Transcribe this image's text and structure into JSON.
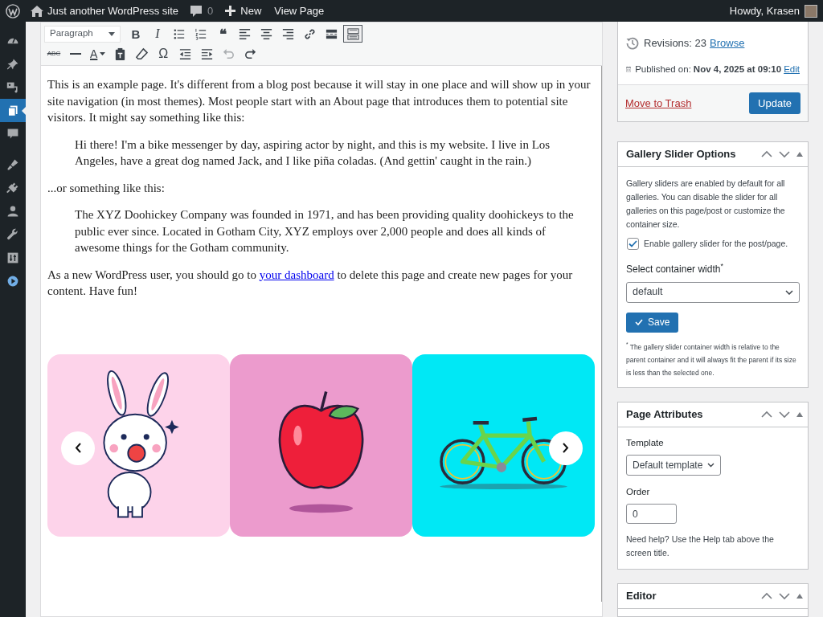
{
  "admin_bar": {
    "site_name": "Just another WordPress site",
    "comments_count": "0",
    "new_label": "New",
    "view_label": "View Page",
    "greeting": "Howdy, Krasen"
  },
  "admin_menu": [
    {
      "kind": "dashboard",
      "selected": false
    },
    {
      "kind": "pin",
      "selected": false
    },
    {
      "kind": "media",
      "selected": false
    },
    {
      "kind": "pages",
      "selected": true
    },
    {
      "kind": "comments",
      "selected": false
    },
    {
      "kind": "brush",
      "selected": false
    },
    {
      "kind": "plug",
      "selected": false
    },
    {
      "kind": "user",
      "selected": false
    },
    {
      "kind": "wrench",
      "selected": false
    },
    {
      "kind": "sliders",
      "selected": false
    },
    {
      "kind": "play",
      "selected": false
    }
  ],
  "toolbar": {
    "format": "Paragraph",
    "row_1": [
      {
        "kind": "bold",
        "glyph": "B",
        "active": false
      },
      {
        "kind": "italic",
        "glyph": "I",
        "active": false
      },
      {
        "kind": "bullets",
        "active": false
      },
      {
        "kind": "numbers",
        "active": false
      },
      {
        "kind": "quote",
        "glyph": "❝",
        "active": false
      },
      {
        "kind": "align-left",
        "active": false
      },
      {
        "kind": "align-center",
        "active": false
      },
      {
        "kind": "align-right",
        "active": false
      },
      {
        "kind": "link",
        "active": false
      },
      {
        "kind": "more",
        "active": false
      },
      {
        "kind": "keyboard",
        "active": true
      }
    ],
    "row_2": [
      {
        "kind": "strike",
        "glyph": "ABC",
        "disabled": false
      },
      {
        "kind": "hr",
        "disabled": false
      },
      {
        "kind": "color",
        "glyph": "A",
        "disabled": false
      },
      {
        "kind": "paste",
        "disabled": false
      },
      {
        "kind": "eraser",
        "disabled": false
      },
      {
        "kind": "omega",
        "glyph": "Ω",
        "disabled": false
      },
      {
        "kind": "outdent",
        "disabled": false
      },
      {
        "kind": "indent",
        "disabled": false
      },
      {
        "kind": "undo",
        "disabled": true
      },
      {
        "kind": "redo",
        "disabled": false
      }
    ]
  },
  "content": [
    {
      "kind": "paragraph",
      "text": "This is an example page. It's different from a blog post because it will stay in one place and will show up in your site navigation (in most themes). Most people start with an About page that introduces them to potential site visitors. It might say something like this:"
    },
    {
      "kind": "quote",
      "text": "Hi there! I'm a bike messenger by day, aspiring actor by night, and this is my website. I live in Los Angeles, have a great dog named Jack, and I like piña coladas. (And gettin' caught in the rain.)"
    },
    {
      "kind": "paragraph",
      "text": "...or something like this:"
    },
    {
      "kind": "quote",
      "text": "The XYZ Doohickey Company was founded in 1971, and has been providing quality doohickeys to the public ever since. Located in Gotham City, XYZ employs over 2,000 people and does all kinds of awesome things for the Gotham community."
    },
    {
      "kind": "link_paragraph",
      "before": "As a new WordPress user, you should go to ",
      "link": "your dashboard",
      "after": " to delete this page and create new pages for your content. Have fun!"
    }
  ],
  "gallery": {
    "slides": [
      {
        "kind": "bunny",
        "color": "#fdd3ea"
      },
      {
        "kind": "apple",
        "color": "#ec9bcd"
      },
      {
        "kind": "bicycle",
        "color": "#00e8f5"
      }
    ]
  },
  "publish_box": {
    "revisions_label": "Revisions: 23",
    "browse_link": "Browse",
    "published_label": "Published on:",
    "published_date": "Nov 4, 2025 at 09:10",
    "edit_link": "Edit",
    "trash_link": "Move to Trash",
    "update_button": "Update"
  },
  "gallery_options": {
    "title": "Gallery Slider Options",
    "description": "Gallery sliders are enabled by default for all galleries. You can disable the slider for all galleries on this page/post or customize the container size.",
    "enable_label": "Enable gallery slider for the post/page.",
    "enabled": true,
    "width_label": "Select container width$^{*}$",
    "width_value": "default",
    "save_button": "Save",
    "footnote": "$^{*}$ The gallery slider container width is relative to the parent container and it will always fit the parent if its size is less than the selected one."
  },
  "page_attributes": {
    "title": "Page Attributes",
    "template_label": "Template",
    "template_value": "Default template",
    "order_label": "Order",
    "order_value": "0",
    "help": "Need help? Use the Help tab above the screen title."
  },
  "editor_box": {
    "title": "Editor"
  }
}
